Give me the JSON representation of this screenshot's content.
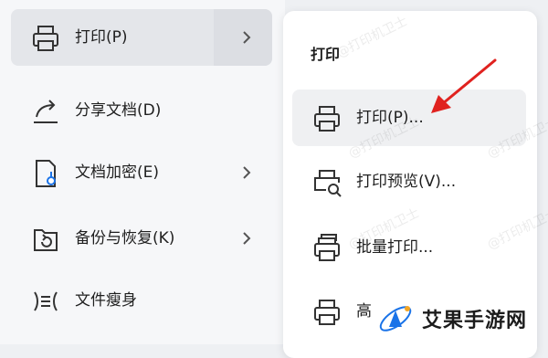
{
  "left_menu": {
    "items": [
      {
        "label": "打印(P)",
        "icon": "printer-icon",
        "has_submenu": true
      },
      {
        "label": "分享文档(D)",
        "icon": "share-icon",
        "has_submenu": false
      },
      {
        "label": "文档加密(E)",
        "icon": "encrypt-doc-icon",
        "has_submenu": true
      },
      {
        "label": "备份与恢复(K)",
        "icon": "backup-icon",
        "has_submenu": true
      },
      {
        "label": "文件瘦身",
        "icon": "slim-icon",
        "has_submenu": false
      }
    ]
  },
  "submenu": {
    "title": "打印",
    "items": [
      {
        "label": "打印(P)...",
        "icon": "printer-icon"
      },
      {
        "label": "打印预览(V)...",
        "icon": "print-preview-icon"
      },
      {
        "label": "批量打印...",
        "icon": "batch-print-icon"
      },
      {
        "label": "高",
        "icon": "advanced-print-icon"
      }
    ]
  },
  "watermark": "@打印机卫士",
  "brand": {
    "name": "艾果手游网",
    "accent": "#1a73e8"
  },
  "arrow_color": "#e0221f"
}
